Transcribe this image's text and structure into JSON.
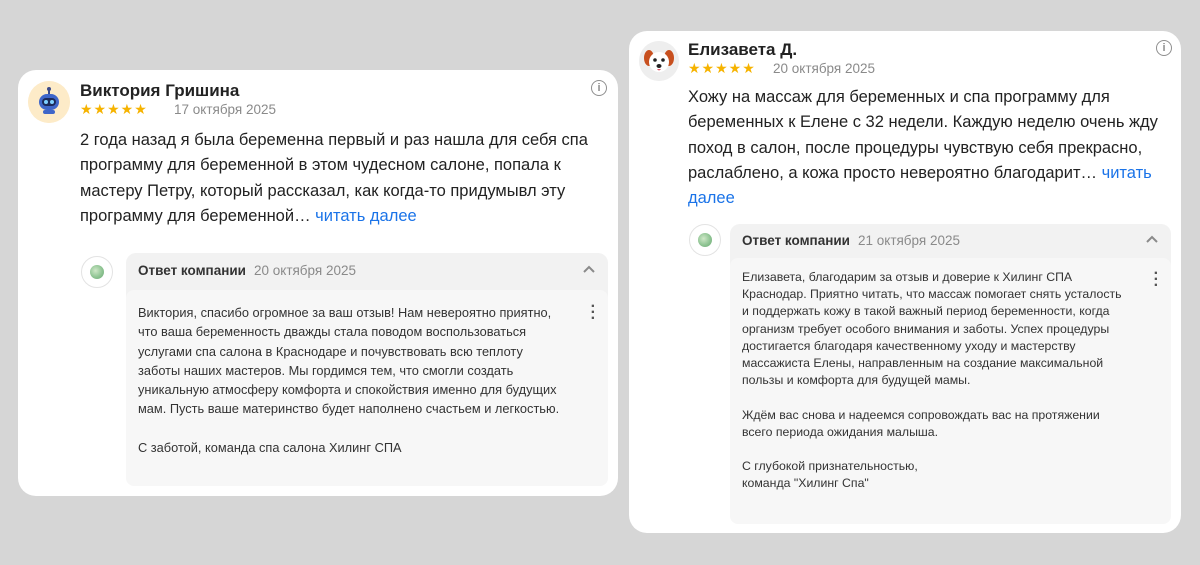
{
  "reviews": [
    {
      "author": "Виктория Гришина",
      "stars": "★★★★★",
      "rating": 5,
      "date": "17 октября 2025",
      "text": "2 года назад я была беременна первый и раз нашла для себя спа программу для беременной в этом чудесном салоне, попала к мастеру Петру, который рассказал, как когда-то придумывл эту программу для беременной…",
      "read_more": "читать далее",
      "reply": {
        "label": "Ответ компании",
        "date": "20 октября 2025",
        "text": "Виктория, спасибо огромное за ваш отзыв! Нам невероятно приятно, что ваша беременность дважды стала поводом воспользоваться услугами спа салона в Краснодаре и почувствовать всю теплоту заботы наших мастеров. Мы гордимся тем, что смогли создать уникальную атмосферу комфорта и спокойствия именно для будущих мам. Пусть ваше материнство будет наполнено счастьем и легкостью.\n\nС заботой, команда спа салона Хилинг СПА"
      }
    },
    {
      "author": "Елизавета Д.",
      "stars": "★★★★★",
      "rating": 5,
      "date": "20 октября 2025",
      "text": "Хожу на массаж для беременных и спа программу для беременных к Елене с 32 недели. Каждую неделю очень жду поход в салон, после процедуры чувствую себя прекрасно, раслаблено, а кожа просто невероятно благодарит…",
      "read_more": "читать далее",
      "reply": {
        "label": "Ответ компании",
        "date": "21 октября 2025",
        "text": "Елизавета, благодарим за отзыв и доверие к Хилинг СПА Краснодар. Приятно читать, что массаж помогает снять усталость и поддержать кожу в такой важный период беременности, когда организм требует особого внимания и заботы. Успех процедуры достигается благодаря качественному уходу и мастерству массажиста Елены, направленным на создание максимальной пользы и комфорта для будущей мамы.\n\nЖдём вас снова и надеемся сопровождать вас на протяжении всего периода ожидания малыша.\n\nС глубокой признательностью,\nкоманда \"Хилинг Спа\""
      }
    }
  ],
  "icons": {
    "info": "i",
    "collapse": "chevron-up",
    "more": "⋮"
  },
  "colors": {
    "star": "#f6b300",
    "link": "#1a73e8",
    "background": "#d6d6d6"
  }
}
